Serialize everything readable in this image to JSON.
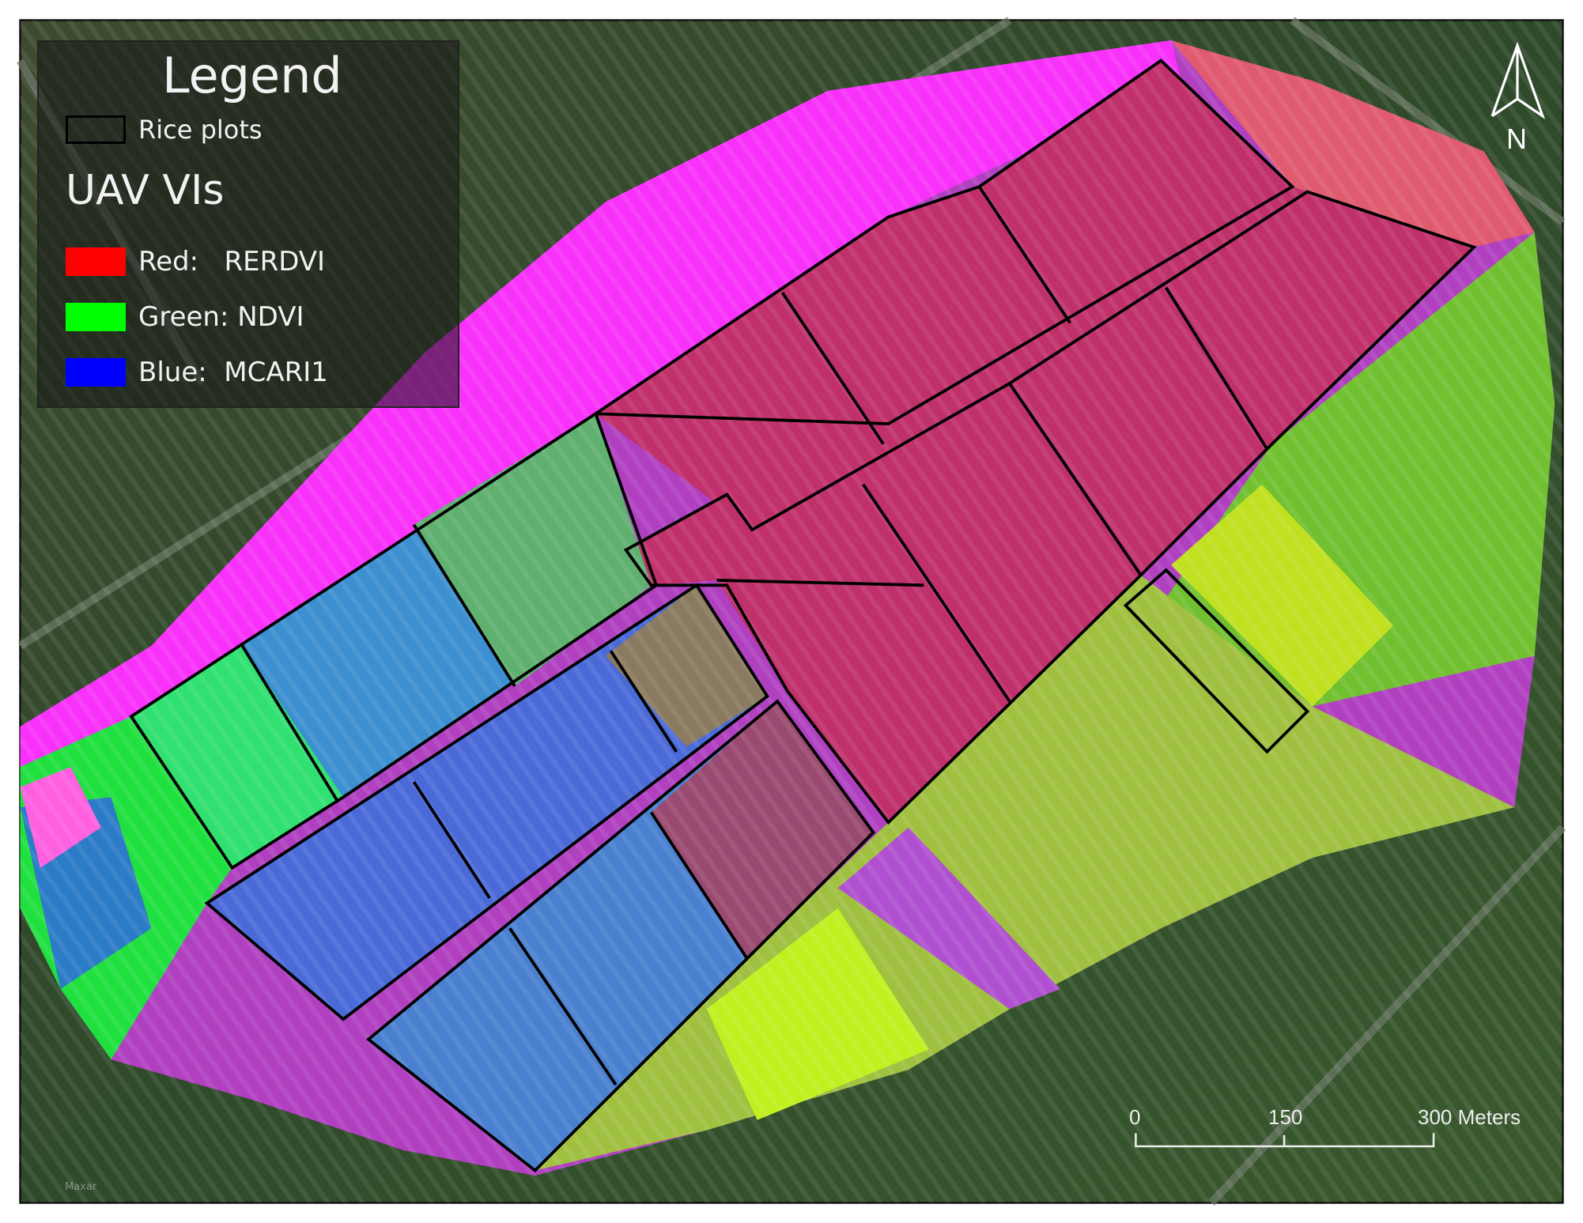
{
  "legend": {
    "title": "Legend",
    "rice_plots": "Rice plots",
    "subtitle": "UAV VIs",
    "items": [
      {
        "label": "Red:   RERDVI",
        "color": "#ff0000"
      },
      {
        "label": "Green: NDVI",
        "color": "#00ff00"
      },
      {
        "label": "Blue:  MCARI1",
        "color": "#0000ff"
      }
    ]
  },
  "scale_bar": {
    "labels": [
      "0",
      "150",
      "300 Meters"
    ]
  },
  "north_arrow": {
    "label": "N"
  },
  "attribution": "Maxar"
}
